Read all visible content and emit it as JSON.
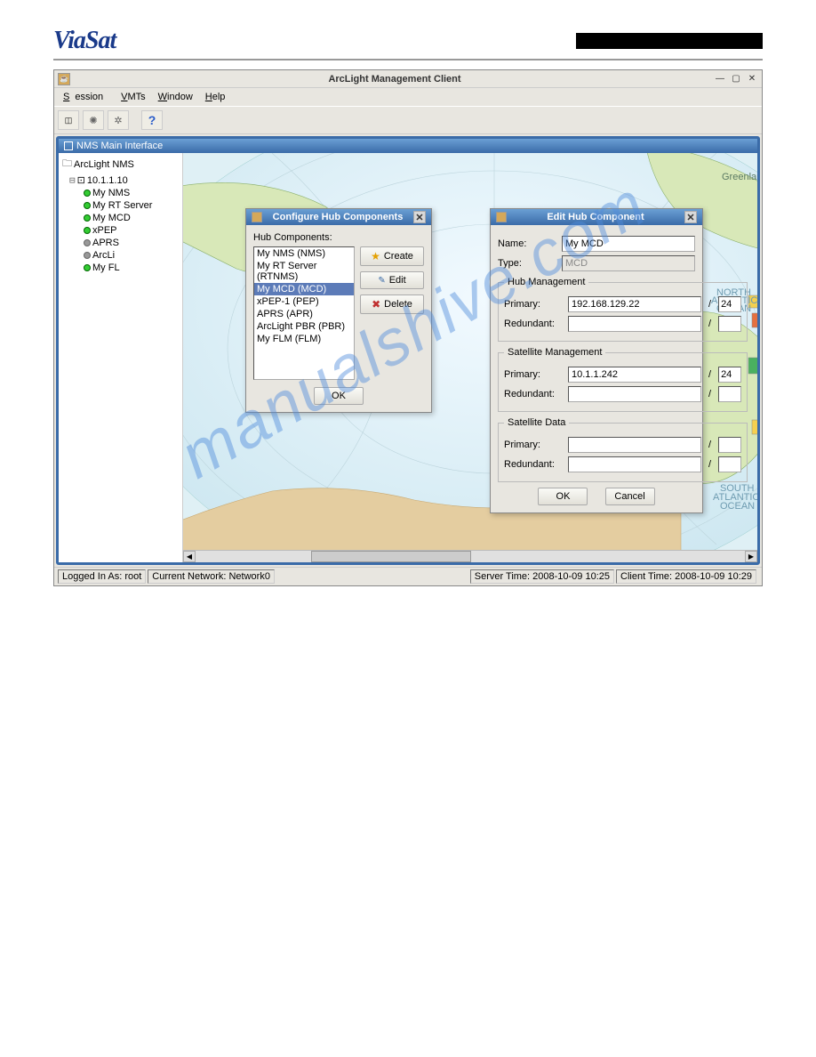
{
  "logo": "ViaSat",
  "app": {
    "title": "ArcLight Management Client",
    "menus": [
      "Session",
      "VMTs",
      "Window",
      "Help"
    ],
    "inner_title": "NMS Main Interface",
    "tree": {
      "root": "ArcLight NMS",
      "ip": "10.1.1.10",
      "items": [
        {
          "label": "My NMS",
          "dot": "green"
        },
        {
          "label": "My RT Server",
          "dot": "green"
        },
        {
          "label": "My MCD",
          "dot": "green"
        },
        {
          "label": "xPEP",
          "dot": "green"
        },
        {
          "label": "APRS",
          "dot": "gray"
        },
        {
          "label": "ArcLi",
          "dot": "gray"
        },
        {
          "label": "My FL",
          "dot": "green"
        }
      ]
    },
    "status": {
      "login": "Logged In As: root",
      "net": "Current Network: Network0",
      "server": "Server Time: 2008-10-09 10:25",
      "client": "Client Time: 2008-10-09 10:29"
    }
  },
  "dlg_hub": {
    "title": "Configure Hub Components",
    "label": "Hub Components:",
    "items": [
      "My NMS (NMS)",
      "My RT Server (RTNMS)",
      "My MCD (MCD)",
      "xPEP-1 (PEP)",
      "APRS (APR)",
      "ArcLight PBR (PBR)",
      "My FLM (FLM)"
    ],
    "selected": 2,
    "btn_create": "Create",
    "btn_edit": "Edit",
    "btn_delete": "Delete",
    "btn_ok": "OK"
  },
  "dlg_edit": {
    "title": "Edit Hub Component",
    "name_label": "Name:",
    "name_value": "My MCD",
    "type_label": "Type:",
    "type_value": "MCD",
    "group_hub": "Hub Management",
    "group_sat_mgmt": "Satellite Management",
    "group_sat_data": "Satellite Data",
    "primary_label": "Primary:",
    "redundant_label": "Redundant:",
    "hub_primary_ip": "192.168.129.22",
    "hub_primary_mask": "24",
    "hub_redundant_ip": "",
    "hub_redundant_mask": "",
    "sat_primary_ip": "10.1.1.242",
    "sat_primary_mask": "24",
    "sat_redundant_ip": "",
    "sat_redundant_mask": "",
    "data_primary_ip": "",
    "data_primary_mask": "",
    "data_redundant_ip": "",
    "data_redundant_mask": "",
    "btn_ok": "OK",
    "btn_cancel": "Cancel"
  },
  "watermark": "manualshive.com"
}
